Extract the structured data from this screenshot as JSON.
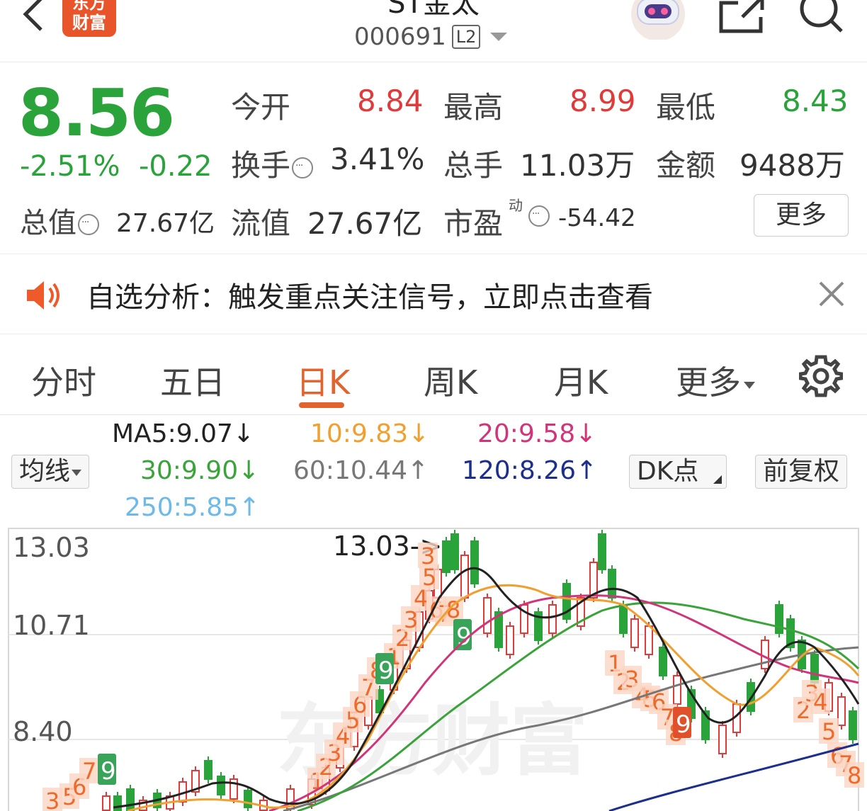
{
  "header": {
    "title": "ST金太",
    "logo_text": [
      "东方",
      "财富"
    ],
    "code": "000691",
    "level": "L2",
    "icons": [
      "back-icon",
      "robot-assistant-icon",
      "share-icon",
      "search-icon"
    ]
  },
  "quote": {
    "price": "8.56",
    "change_pct": "-2.51%",
    "change_abs": "-0.22",
    "open_label": "今开",
    "open": "8.84",
    "high_label": "最高",
    "high": "8.99",
    "low_label": "最低",
    "low": "8.43",
    "turnover_label": "换手",
    "turnover": "3.41%",
    "volume_label": "总手",
    "volume": "11.03万",
    "amount_label": "金额",
    "amount": "9488万",
    "mktcap_label": "总值",
    "mktcap": "27.67亿",
    "float_label": "流值",
    "float_cap": "27.67亿",
    "pe_label": "市盈",
    "pe_sup": "动",
    "pe": "-54.42",
    "more": "更多",
    "colors": {
      "up": "#e03b3b",
      "down": "#2aa33a"
    }
  },
  "notice": {
    "text": "自选分析：触发重点关注信号，立即点击查看"
  },
  "tabs": {
    "items": [
      "分时",
      "五日",
      "日K",
      "周K",
      "月K",
      "更多"
    ],
    "active": "日K"
  },
  "ma": {
    "selector": "均线",
    "ma5": "MA5:9.07↓",
    "ma10": "10:9.83↓",
    "ma20": "20:9.58↓",
    "ma30": "30:9.90↓",
    "ma60": "60:10.44↑",
    "ma120": "120:8.26↑",
    "ma250": "250:5.85↑",
    "dk": "DK点",
    "adjust": "前复权",
    "colors": {
      "ma5": "#222222",
      "ma10": "#f0a030",
      "ma20": "#d0357a",
      "ma30": "#3aa33a",
      "ma60": "#777777",
      "ma120": "#1c2f8a",
      "ma250": "#6db9e8"
    }
  },
  "chart_data": {
    "type": "candlestick",
    "y_ticks": [
      "13.03",
      "10.71",
      "8.40"
    ],
    "annotation": "13.03->",
    "watermark": "东方财富",
    "ylim": [
      6.0,
      13.03
    ]
  }
}
